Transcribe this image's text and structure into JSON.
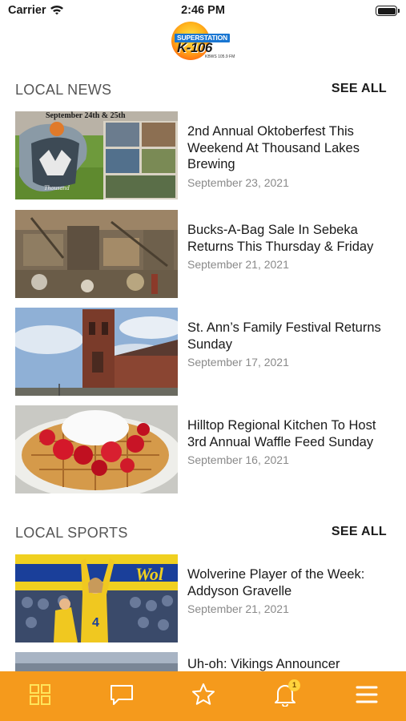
{
  "status_bar": {
    "carrier": "Carrier",
    "time": "2:46 PM"
  },
  "logo": {
    "top_text": "SUPERSTATION",
    "main_text": "K-106",
    "sub_text": "KBWS 105.9 FM"
  },
  "local_news": {
    "title": "LOCAL NEWS",
    "see_all": "SEE ALL",
    "articles": [
      {
        "title": "2nd Annual Oktoberfest This Weekend At Thousand Lakes Brewing",
        "date": "September 23, 2021",
        "image_caption": "September 24th & 25th",
        "image_logo": "Thousand"
      },
      {
        "title": "Bucks-A-Bag Sale In Sebeka Returns This Thursday & Friday",
        "date": "September 21, 2021"
      },
      {
        "title": "St. Ann’s Family Festival Returns Sunday",
        "date": "September 17, 2021"
      },
      {
        "title": "Hilltop Regional Kitchen To Host 3rd Annual Waffle Feed Sunday",
        "date": "September 16, 2021"
      }
    ]
  },
  "local_sports": {
    "title": "LOCAL SPORTS",
    "see_all": "SEE ALL",
    "articles": [
      {
        "title": "Wolverine Player of the Week: Addyson Gravelle",
        "date": "September 21, 2021",
        "jersey_number": "4",
        "banner_text": "Wol"
      },
      {
        "title": "Uh-oh: Vikings Announcer",
        "date": ""
      }
    ]
  },
  "tab_bar": {
    "accent_color": "#f59a1c",
    "tabs": [
      {
        "name": "grid-icon",
        "active": true
      },
      {
        "name": "chat-icon",
        "active": false
      },
      {
        "name": "star-icon",
        "active": false
      },
      {
        "name": "bell-icon",
        "active": false,
        "badge": "1"
      },
      {
        "name": "menu-icon",
        "active": false
      }
    ]
  }
}
